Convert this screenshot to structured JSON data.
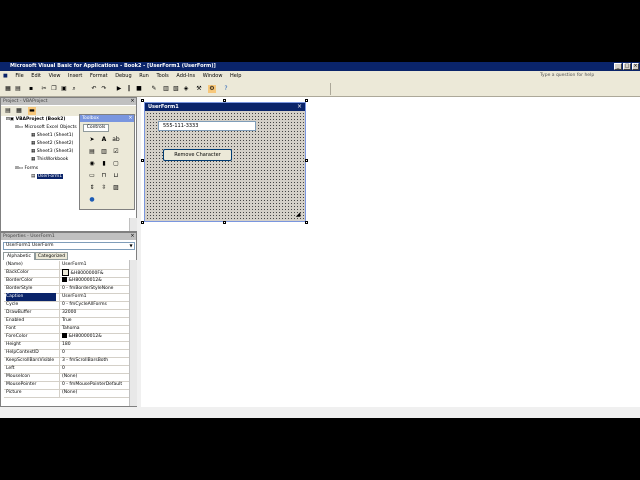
{
  "window": {
    "title": "Microsoft Visual Basic for Applications - Book2 - [UserForm1 (UserForm)]"
  },
  "menubar": {
    "items": [
      "File",
      "Edit",
      "View",
      "Insert",
      "Format",
      "Debug",
      "Run",
      "Tools",
      "Add-Ins",
      "Window",
      "Help"
    ],
    "help_box": "Type a question for help"
  },
  "project": {
    "title": "Project - VBAProject",
    "tree": [
      {
        "label": "VBAProject (Book2)"
      },
      {
        "label": "Microsoft Excel Objects"
      },
      {
        "label": "Sheet1 (Sheet1)"
      },
      {
        "label": "Sheet2 (Sheet2)"
      },
      {
        "label": "Sheet3 (Sheet3)"
      },
      {
        "label": "ThisWorkbook"
      },
      {
        "label": "Forms"
      },
      {
        "label": "UserForm1"
      }
    ]
  },
  "properties": {
    "title": "Properties - UserForm1",
    "object": "UserForm1 UserForm",
    "tabs": [
      "Alphabetic",
      "Categorized"
    ],
    "rows": [
      {
        "k": "(Name)",
        "v": "UserForm1"
      },
      {
        "k": "BackColor",
        "v": "&H8000000F&"
      },
      {
        "k": "BorderColor",
        "v": "&H80000012&"
      },
      {
        "k": "BorderStyle",
        "v": "0 - fmBorderStyleNone"
      },
      {
        "k": "Caption",
        "v": "UserForm1"
      },
      {
        "k": "Cycle",
        "v": "0 - fmCycleAllForms"
      },
      {
        "k": "DrawBuffer",
        "v": "32000"
      },
      {
        "k": "Enabled",
        "v": "True"
      },
      {
        "k": "Font",
        "v": "Tahoma"
      },
      {
        "k": "ForeColor",
        "v": "&H80000012&"
      },
      {
        "k": "Height",
        "v": "180"
      },
      {
        "k": "HelpContextID",
        "v": "0"
      },
      {
        "k": "KeepScrollBarsVisible",
        "v": "3 - fmScrollBarsBoth"
      },
      {
        "k": "Left",
        "v": "0"
      },
      {
        "k": "MouseIcon",
        "v": "(None)"
      },
      {
        "k": "MousePointer",
        "v": "0 - fmMousePointerDefault"
      },
      {
        "k": "Picture",
        "v": "(None)"
      }
    ]
  },
  "toolbox": {
    "title": "Toolbox",
    "tab": "Controls"
  },
  "userform": {
    "title": "UserForm1",
    "textbox_value": "555-111-3333",
    "button_label": "Remove Character"
  }
}
